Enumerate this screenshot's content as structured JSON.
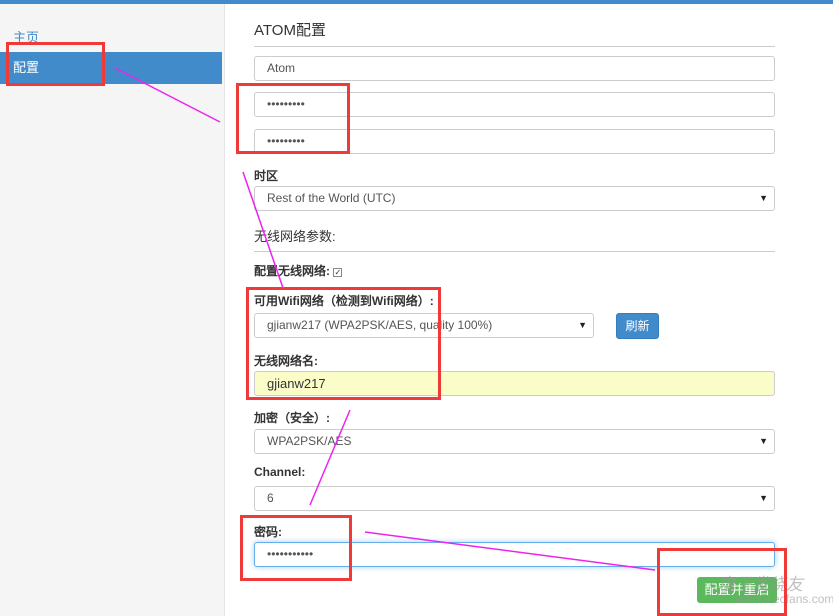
{
  "sidebar": {
    "items": [
      {
        "label": "主页"
      },
      {
        "label": "配置"
      }
    ]
  },
  "form": {
    "section_atom": "ATOM配置",
    "name_value": "Atom",
    "password_value": "•••••••••",
    "password_confirm_value": "•••••••••",
    "timezone_label": "时区",
    "timezone_value": "Rest of the World (UTC)",
    "section_wifi": "无线网络参数:",
    "configure_wifi_label": "配置无线网络:",
    "available_wifi_label": "可用Wifi网络（检测到Wifi网络）:",
    "available_wifi_value": "gjianw217 (WPA2PSK/AES, quality 100%)",
    "refresh_label": "刷新",
    "ssid_label": "无线网络名:",
    "ssid_value": "gjianw217",
    "encryption_label": "加密（安全）:",
    "encryption_value": "WPA2PSK/AES",
    "channel_label": "Channel:",
    "channel_value": "6",
    "wifi_password_label": "密码:",
    "wifi_password_value": "•••••••••••",
    "submit_label": "配置并重启"
  },
  "watermark": {
    "text": "电子发烧友",
    "url": "www.elecfans.com"
  },
  "colors": {
    "primary": "#428bca",
    "success": "#5cb85c",
    "annotation_red": "#ef3a3a",
    "annotation_arrow": "#ee22ee"
  }
}
